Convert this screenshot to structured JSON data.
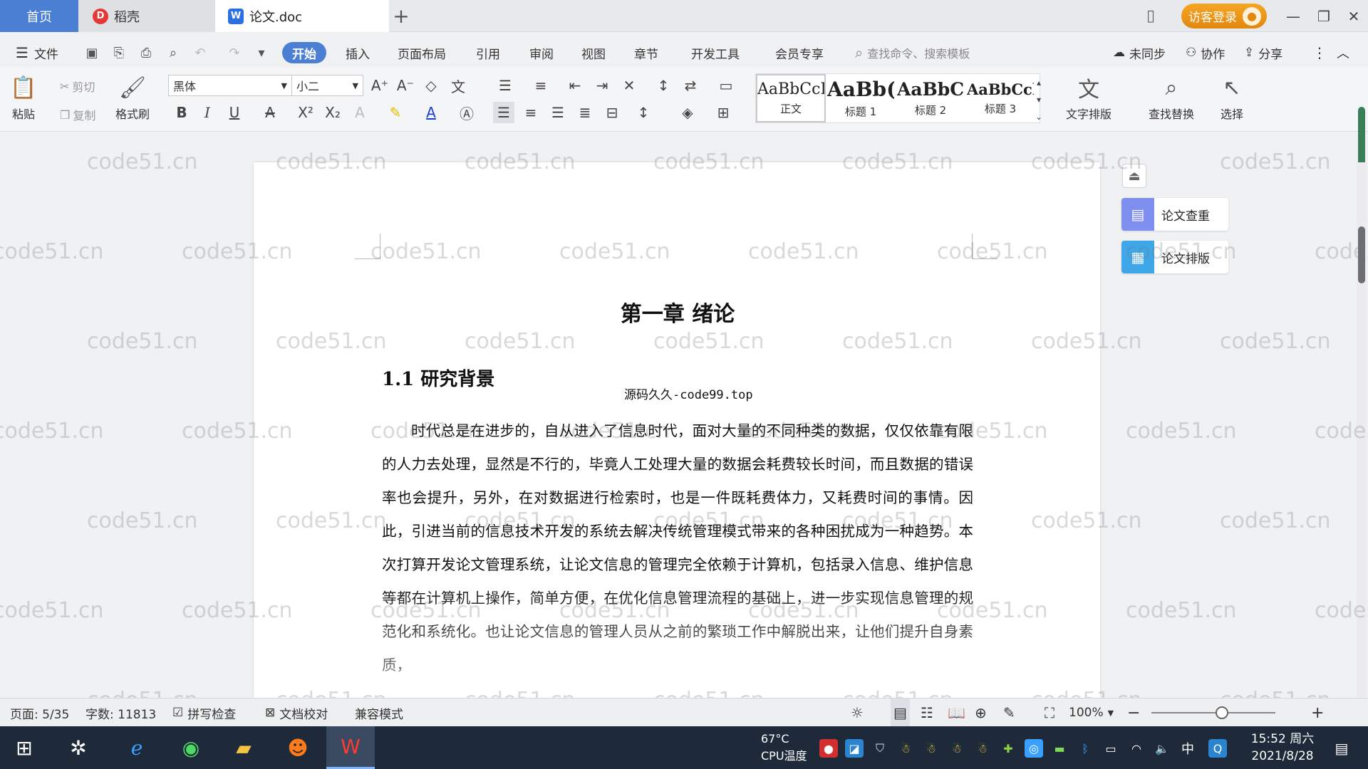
{
  "tabs": {
    "home": "首页",
    "daoke": "稻壳",
    "document": "论文.doc",
    "add": "+",
    "login": "访客登录"
  },
  "menu": {
    "file": "文件",
    "items": [
      "开始",
      "插入",
      "页面布局",
      "引用",
      "审阅",
      "视图",
      "章节",
      "开发工具",
      "会员专享"
    ],
    "search_placeholder": "查找命令、搜索模板",
    "unsynced": "未同步",
    "collaborate": "协作",
    "share": "分享"
  },
  "ribbon": {
    "paste": "粘贴",
    "cut": "剪切",
    "copy": "复制",
    "format_painter": "格式刷",
    "font_name": "黑体",
    "font_size": "小二",
    "styles": [
      {
        "preview": "AaBbCcI",
        "name": "正文"
      },
      {
        "preview": "AaBb(",
        "name": "标题 1"
      },
      {
        "preview": "AaBbC",
        "name": "标题 2"
      },
      {
        "preview": "AaBbCcl",
        "name": "标题 3"
      }
    ],
    "text_layout": "文字排版",
    "find_replace": "查找替换",
    "select": "选择"
  },
  "side_panel": {
    "check": "论文查重",
    "layout": "论文排版"
  },
  "document": {
    "chapter_title": "第一章  绪论",
    "section_title": "1.1  研究背景",
    "source_note": "源码久久-code99.top",
    "paragraph": "时代总是在进步的，自从进入了信息时代，面对大量的不同种类的数据，仅仅依靠有限的人力去处理，显然是不行的，毕竟人工处理大量的数据会耗费较长时间，而且数据的错误率也会提升，另外，在对数据进行检索时，也是一件既耗费体力，又耗费时间的事情。因此，引进当前的信息技术开发的系统去解决传统管理模式带来的各种困扰成为一种趋势。本次打算开发论文管理系统，让论文信息的管理完全依赖于计算机，包括录入信息、维护信息等都在计算机上操作，简单方便，在优化信息管理流程的基础上，进一步实现信息管理的规范化和系统化。也让论文信息的管理人员从之前的繁琐工作中解脱出来，让他们提升自身素质，"
  },
  "watermark": "code51.cn",
  "status": {
    "page": "页面: 5/35",
    "words": "字数: 11813",
    "spell_check": "拼写检查",
    "doc_proof": "文档校对",
    "compat_mode": "兼容模式",
    "zoom": "100%"
  },
  "taskbar": {
    "cpu_temp": "67°C",
    "cpu_label": "CPU温度",
    "ime": "中",
    "time": "15:52 周六",
    "date": "2021/8/28"
  }
}
